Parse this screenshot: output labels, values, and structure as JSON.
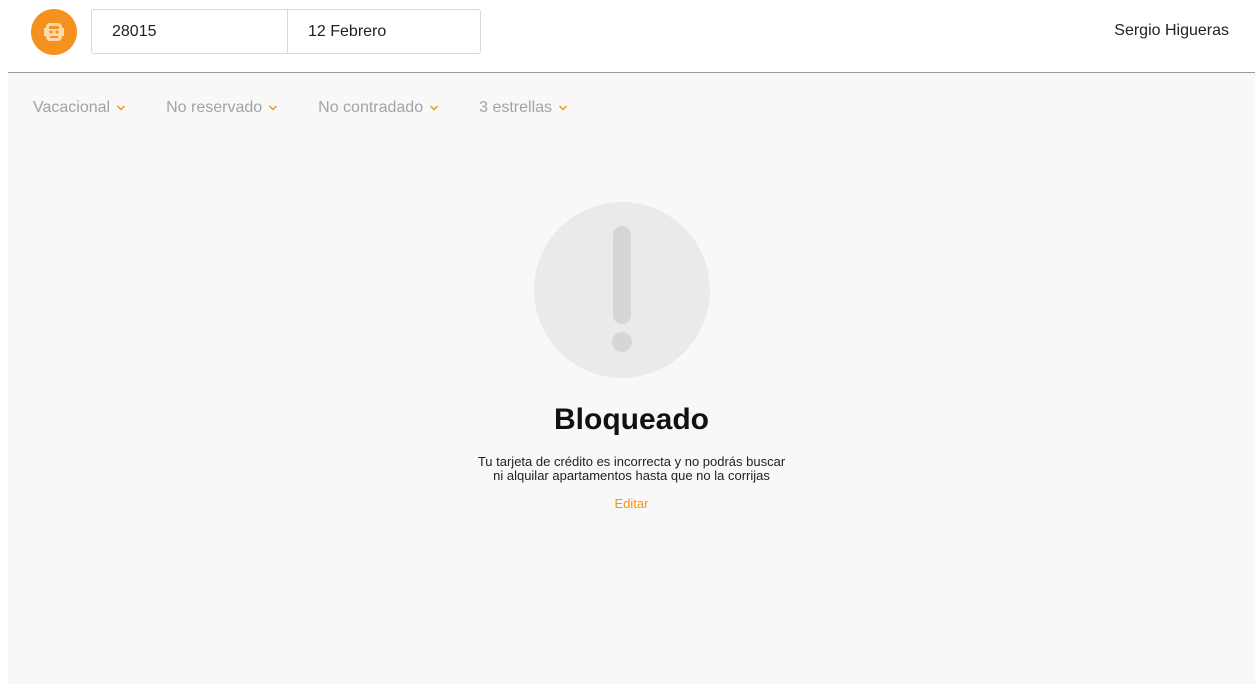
{
  "header": {
    "logo_icon": "brand-logo-icon",
    "zip_value": "28015",
    "date_value": "12 Febrero",
    "user_name": "Sergio Higueras"
  },
  "filters": [
    {
      "label": "Vacacional",
      "icon": "chevron-down-icon"
    },
    {
      "label": "No reservado",
      "icon": "chevron-down-icon"
    },
    {
      "label": "No contradado",
      "icon": "chevron-down-icon"
    },
    {
      "label": "3 estrellas",
      "icon": "chevron-down-icon"
    }
  ],
  "blocked": {
    "icon": "exclamation-icon",
    "title": "Bloqueado",
    "message_line1": "Tu tarjeta de crédito es incorrecta y no podrás buscar",
    "message_line2": "ni alquilar apartamentos hasta que no la corrijas",
    "edit_label": "Editar"
  },
  "colors": {
    "accent": "#f5921f",
    "muted_text": "#a3a3a3",
    "content_background": "#f8f8f8",
    "icon_circle": "#eaeaea",
    "icon_glyph": "#d6d6d6"
  }
}
